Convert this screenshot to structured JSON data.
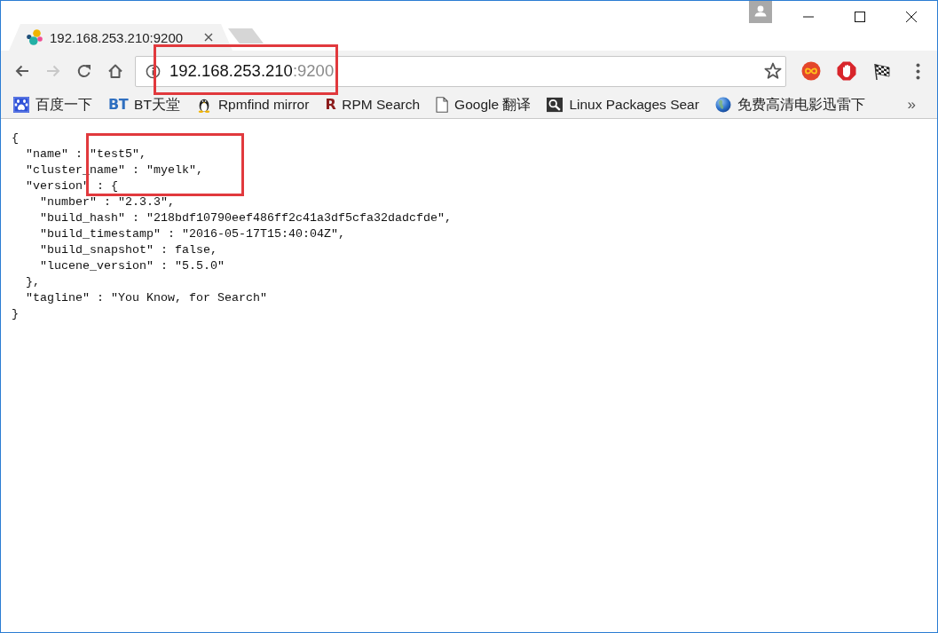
{
  "tabs": [
    {
      "title": "192.168.253.210:9200",
      "selected": true
    }
  ],
  "nav_buttons": [
    {
      "kind": "back",
      "disabled": false
    },
    {
      "kind": "forward",
      "disabled": true
    },
    {
      "kind": "reload",
      "disabled": false
    },
    {
      "kind": "home",
      "disabled": false
    }
  ],
  "address_bar": {
    "host": "192.168.253.210",
    "port": ":9200",
    "highlighted": true
  },
  "bookmarks": [
    {
      "kind": "paw",
      "label": "百度一下"
    },
    {
      "kind": "letters",
      "icon_text": "BT",
      "color": "#2f6fc0",
      "label": "BT天堂"
    },
    {
      "kind": "penguin",
      "label": "Rpmfind mirror"
    },
    {
      "kind": "letters",
      "icon_text": "R",
      "color": "#8c1c1c",
      "label": "RPM Search"
    },
    {
      "kind": "page",
      "label": "Google 翻译"
    },
    {
      "kind": "search",
      "label": "Linux Packages Sear"
    },
    {
      "kind": "globe",
      "label": "免费高清电影迅雷下"
    }
  ],
  "bookmarks_overflow": "»",
  "page": {
    "highlighted": true,
    "lines": [
      {
        "text": "{",
        "children": [
          {
            "text": "\"name\" : \"test5\","
          },
          {
            "text": "\"cluster_name\" : \"myelk\","
          },
          {
            "text": "\"version\" : {",
            "children": [
              {
                "text": "\"number\" : \"2.3.3\","
              },
              {
                "text": "\"build_hash\" : \"218bdf10790eef486ff2c41a3df5cfa32dadcfde\","
              },
              {
                "text": "\"build_timestamp\" : \"2016-05-17T15:40:04Z\","
              },
              {
                "text": "\"build_snapshot\" : false,"
              },
              {
                "text": "\"lucene_version\" : \"5.5.0\""
              }
            ]
          },
          {
            "text": "},"
          },
          {
            "text": "\"tagline\" : \"You Know, for Search\""
          }
        ]
      },
      {
        "text": "}"
      }
    ]
  }
}
